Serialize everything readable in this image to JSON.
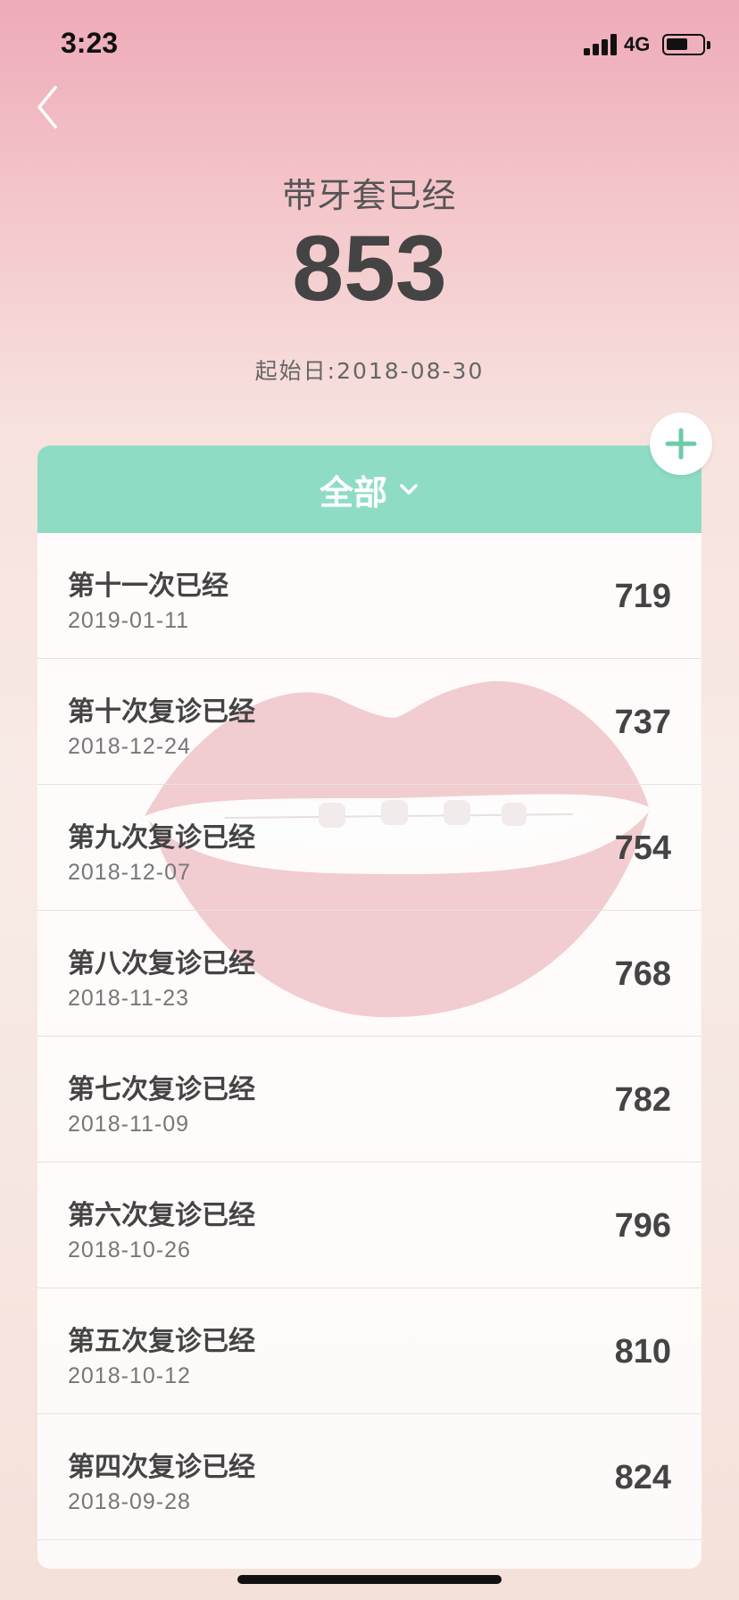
{
  "status_bar": {
    "time": "3:23",
    "network": "4G",
    "signal_icon": "cellular-signal-icon",
    "battery_icon": "battery-icon",
    "battery_level": 0.6
  },
  "navigation": {
    "back_icon": "chevron-left-icon"
  },
  "header": {
    "label": "带牙套已经",
    "total_days": "853",
    "start_date": "起始日:2018-08-30"
  },
  "add_button": {
    "icon": "plus-icon",
    "color": "#6dcca8"
  },
  "filter": {
    "label": "全部",
    "icon": "chevron-down-icon",
    "background": "#8fdcc5"
  },
  "background_art": "lips-with-braces-illustration",
  "visits": [
    {
      "title": "第十一次已经",
      "date": "2019-01-11",
      "days": "719"
    },
    {
      "title": "第十次复诊已经",
      "date": "2018-12-24",
      "days": "737"
    },
    {
      "title": "第九次复诊已经",
      "date": "2018-12-07",
      "days": "754"
    },
    {
      "title": "第八次复诊已经",
      "date": "2018-11-23",
      "days": "768"
    },
    {
      "title": "第七次复诊已经",
      "date": "2018-11-09",
      "days": "782"
    },
    {
      "title": "第六次复诊已经",
      "date": "2018-10-26",
      "days": "796"
    },
    {
      "title": "第五次复诊已经",
      "date": "2018-10-12",
      "days": "810"
    },
    {
      "title": "第四次复诊已经",
      "date": "2018-09-28",
      "days": "824"
    }
  ]
}
